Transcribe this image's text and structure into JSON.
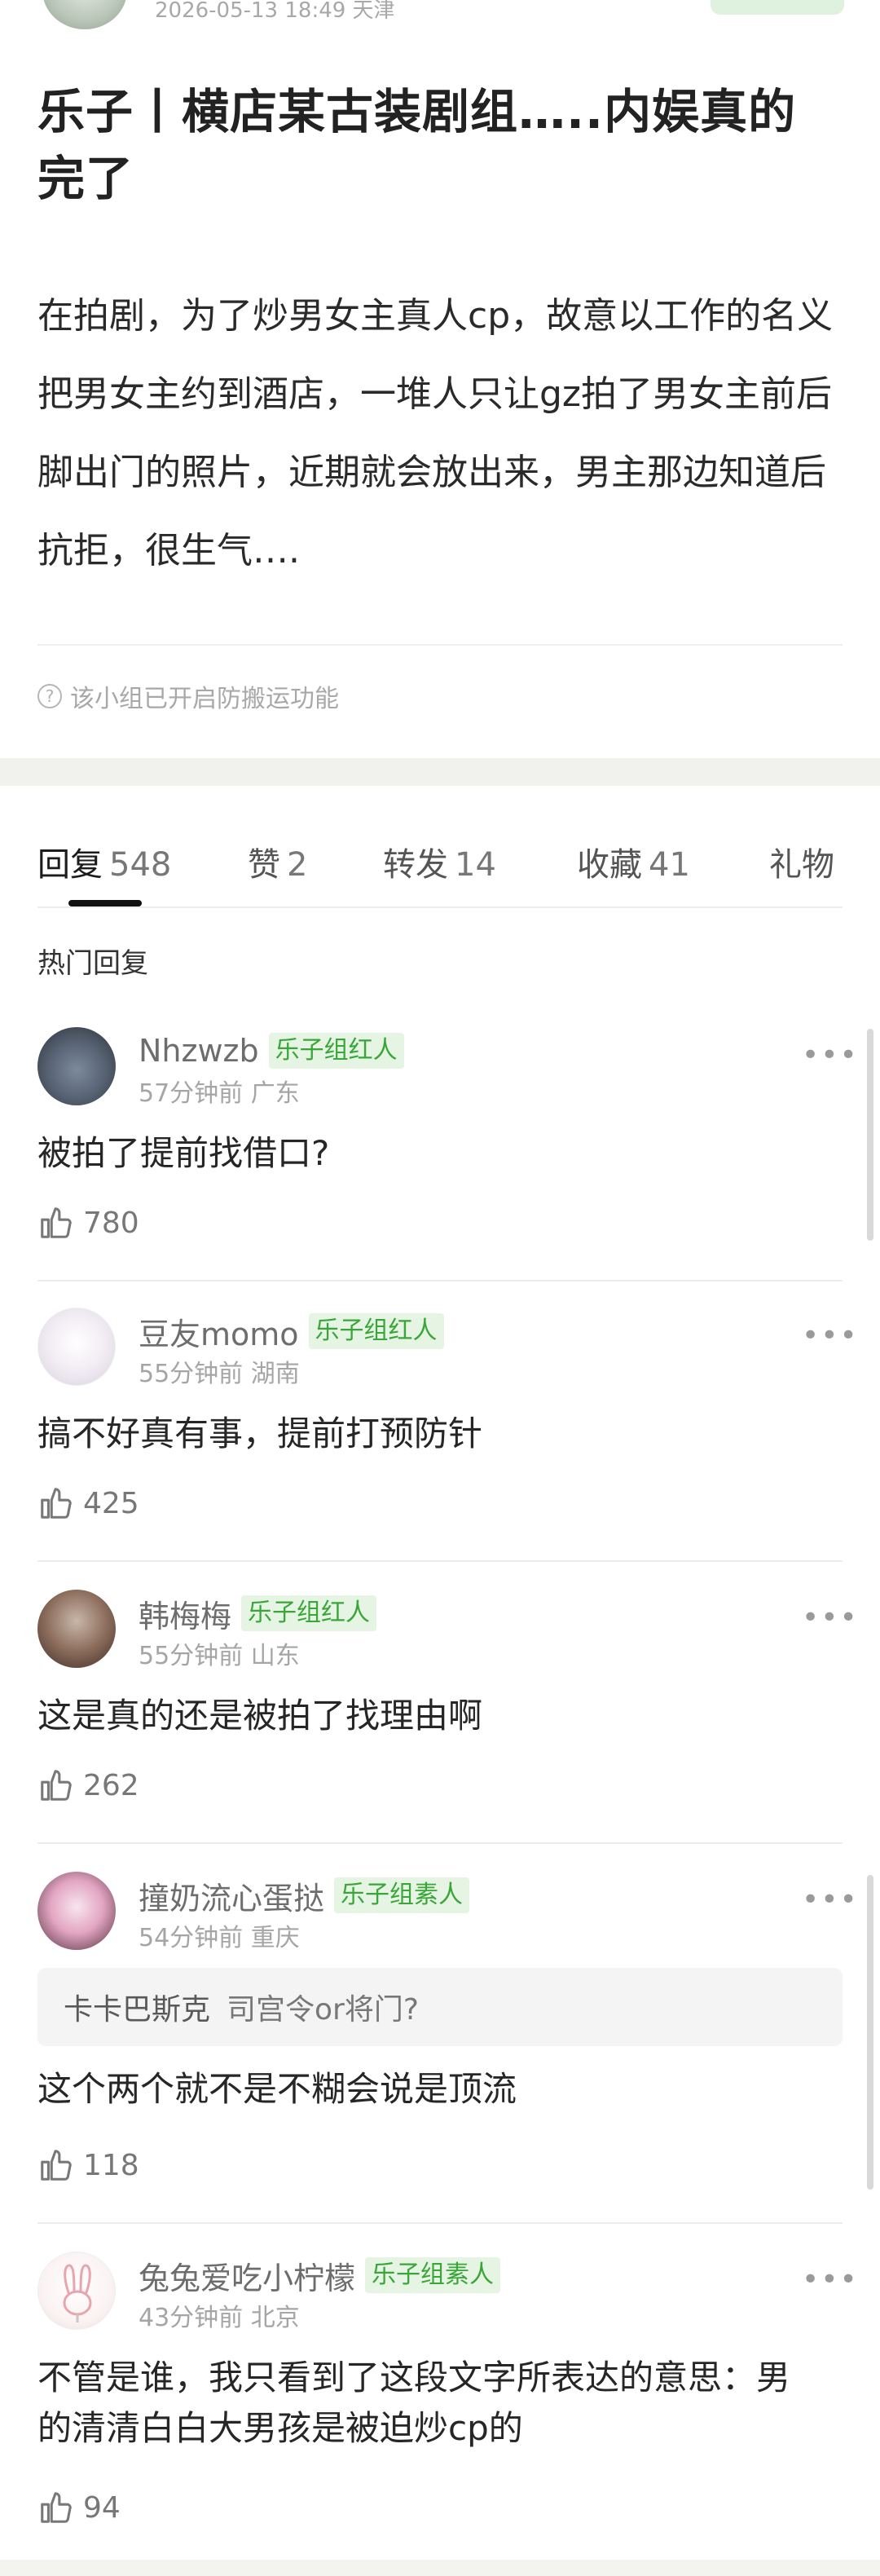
{
  "header": {
    "meta": "2026-05-13 18:49 天津"
  },
  "post": {
    "title": "乐子丨横店某古装剧组…..内娱真的完了",
    "body": "在拍剧，为了炒男女主真人cp，故意以工作的名义把男女主约到酒店，一堆人只让gz拍了男女主前后脚出门的照片，近期就会放出来，男主那边知道后抗拒，很生气….",
    "notice": "该小组已开启防搬运功能",
    "notice_icon": "question-circle-icon"
  },
  "tabs": [
    {
      "label": "回复",
      "count": "548"
    },
    {
      "label": "赞",
      "count": "2"
    },
    {
      "label": "转发",
      "count": "14"
    },
    {
      "label": "收藏",
      "count": "41"
    },
    {
      "label": "礼物",
      "count": ""
    }
  ],
  "section_title": "热门回复",
  "comments": [
    {
      "name": "Nhzwzb",
      "badge": "乐子组红人",
      "time": "57分钟前 广东",
      "text": "被拍了提前找借口?",
      "likes": "780"
    },
    {
      "name": "豆友momo",
      "badge": "乐子组红人",
      "time": "55分钟前 湖南",
      "text": "搞不好真有事，提前打预防针",
      "likes": "425"
    },
    {
      "name": "韩梅梅",
      "badge": "乐子组红人",
      "time": "55分钟前 山东",
      "text": "这是真的还是被拍了找理由啊",
      "likes": "262"
    },
    {
      "name": "撞奶流心蛋挞",
      "badge": "乐子组素人",
      "time": "54分钟前 重庆",
      "quote_user": "卡卡巴斯克",
      "quote_text": "司宫令or将门?",
      "text": "这个两个就不是不糊会说是顶流",
      "likes": "118"
    },
    {
      "name": "兔兔爱吃小柠檬",
      "badge": "乐子组素人",
      "time": "43分钟前 北京",
      "text": "不管是谁，我只看到了这段文字所表达的意思：男的清清白白大男孩是被迫炒cp的",
      "likes": "94"
    }
  ],
  "icons": {
    "more": "more-dots-icon",
    "like": "thumbs-up-icon"
  },
  "colors": {
    "badge_text": "#3aa63a",
    "badge_bg": "#e6f5e3",
    "accent": "#111111"
  }
}
